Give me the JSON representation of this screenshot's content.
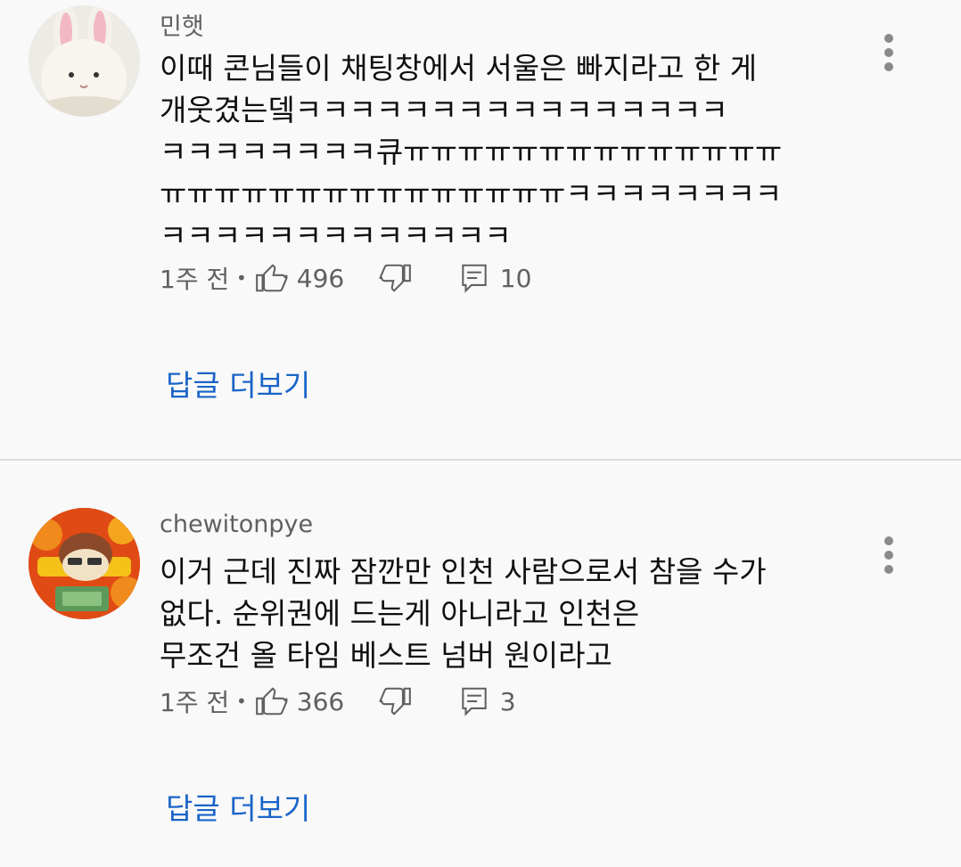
{
  "comments": [
    {
      "author": "민햇",
      "lines": [
        "이때 콘님들이 채팅창에서 서울은 빠지라고 한 게",
        "개웃겼는뎈ㅋㅋㅋㅋㅋㅋㅋㅋㅋㅋㅋㅋㅋㅋㅋㅋ",
        "ㅋㅋㅋㅋㅋㅋㅋㅋ큐ㅠㅠㅠㅠㅠㅠㅠㅠㅠㅠㅠㅠㅠㅠ",
        "ㅠㅠㅠㅠㅠㅠㅠㅠㅠㅠㅠㅠㅠㅠㅠㅋㅋㅋㅋㅋㅋㅋㅋ",
        "ㅋㅋㅋㅋㅋㅋㅋㅋㅋㅋㅋㅋㅋ"
      ],
      "time": "1주 전",
      "dot": "•",
      "likes": "496",
      "replies": "10",
      "view_replies": "답글 더보기",
      "avatar_icon": "white-rabbit-plush-avatar",
      "more_icon": "more-vertical-icon"
    },
    {
      "author": "chewitonpye",
      "lines": [
        "이거 근데 진짜 잠깐만 인천 사람으로서 참을 수가",
        "없다. 순위권에 드는게 아니라고 인천은",
        "무조건 올 타임 베스트 넘버 원이라고"
      ],
      "time": "1주 전",
      "dot": "•",
      "likes": "366",
      "replies": "3",
      "view_replies": "답글 더보기",
      "avatar_icon": "cartoon-character-avatar",
      "more_icon": "more-vertical-icon"
    }
  ],
  "colors": {
    "background": "#f9f9f9",
    "text": "#0f0f0f",
    "secondary": "#606060",
    "link": "#1a64c8",
    "divider": "#dcdcdc"
  }
}
